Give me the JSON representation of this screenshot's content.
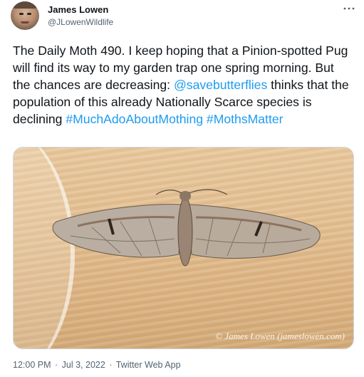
{
  "author": {
    "display_name": "James Lowen",
    "handle": "@JLowenWildlife"
  },
  "more_menu_icon": "more-horizontal-icon",
  "tweet": {
    "text_part1": "The Daily Moth 490. I keep hoping that a Pinion-spotted Pug will find its way to my garden trap one spring morning. But the chances are decreasing: ",
    "mention": "@savebutterflies",
    "text_part2": " thinks that the population of this already Nationally Scarce species is declining ",
    "hashtag1": "#MuchAdoAboutMothing",
    "hashtag2": "#MothsMatter"
  },
  "media": {
    "watermark": "© James Lowen (jameslowen.com)"
  },
  "meta": {
    "time": "12:00 PM",
    "date": "Jul 3, 2022",
    "source": "Twitter Web App",
    "separator": "·"
  },
  "colors": {
    "link": "#1d9bf0",
    "text": "#0f1419",
    "secondary": "#536471"
  }
}
